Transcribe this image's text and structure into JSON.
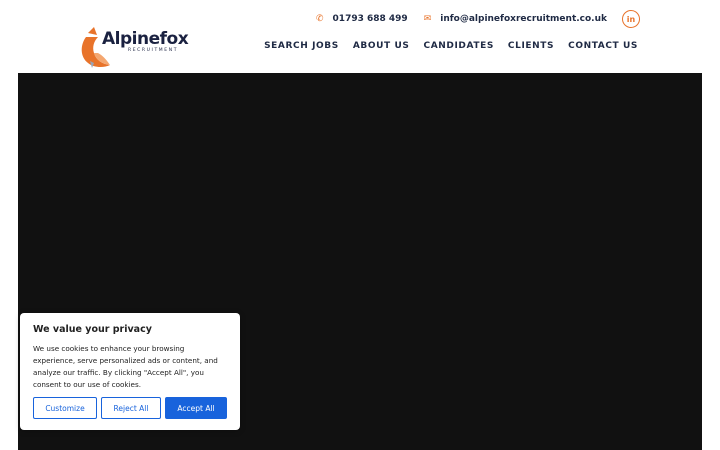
{
  "brand": {
    "name": "Alpinefox",
    "sub": "RECRUITMENT",
    "accent_color": "#e8732a"
  },
  "contact": {
    "phone": "01793 688 499",
    "email": "info@alpinefoxrecruitment.co.uk",
    "phone_icon": "phone-icon",
    "email_icon": "envelope-icon",
    "social_label": "in"
  },
  "nav": {
    "items": [
      {
        "label": "SEARCH JOBS"
      },
      {
        "label": "ABOUT US"
      },
      {
        "label": "CANDIDATES"
      },
      {
        "label": "CLIENTS"
      },
      {
        "label": "CONTACT US"
      }
    ]
  },
  "cookie": {
    "title": "We value your privacy",
    "body": "We use cookies to enhance your browsing experience, serve personalized ads or content, and analyze our traffic. By clicking \"Accept All\", you consent to our use of cookies.",
    "customize_label": "Customize",
    "reject_label": "Reject All",
    "accept_label": "Accept All",
    "button_color": "#1863dc"
  }
}
